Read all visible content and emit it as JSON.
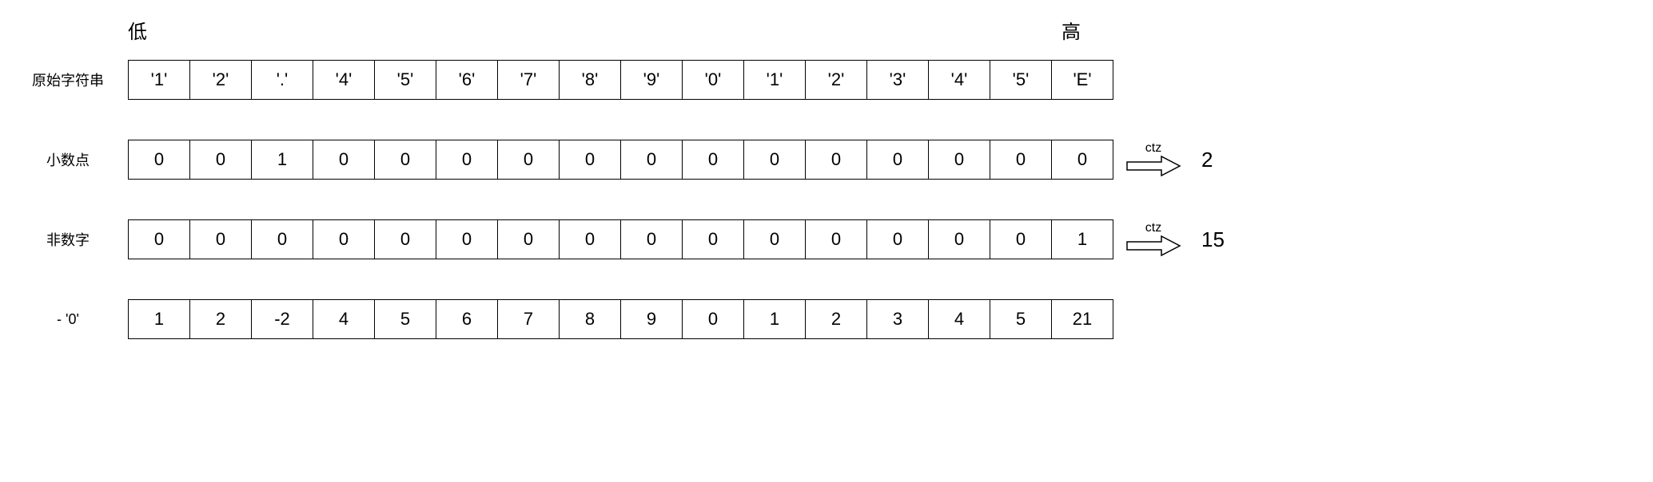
{
  "header": {
    "low": "低",
    "high": "高"
  },
  "rows": [
    {
      "label": "原始字符串",
      "cells": [
        "'1'",
        "'2'",
        "'.'",
        "'4'",
        "'5'",
        "'6'",
        "'7'",
        "'8'",
        "'9'",
        "'0'",
        "'1'",
        "'2'",
        "'3'",
        "'4'",
        "'5'",
        "'E'"
      ],
      "arrow": null,
      "result": null
    },
    {
      "label": "小数点",
      "cells": [
        "0",
        "0",
        "1",
        "0",
        "0",
        "0",
        "0",
        "0",
        "0",
        "0",
        "0",
        "0",
        "0",
        "0",
        "0",
        "0"
      ],
      "arrow": "ctz",
      "result": "2"
    },
    {
      "label": "非数字",
      "cells": [
        "0",
        "0",
        "0",
        "0",
        "0",
        "0",
        "0",
        "0",
        "0",
        "0",
        "0",
        "0",
        "0",
        "0",
        "0",
        "1"
      ],
      "arrow": "ctz",
      "result": "15"
    },
    {
      "label": "- '0'",
      "cells": [
        "1",
        "2",
        "-2",
        "4",
        "5",
        "6",
        "7",
        "8",
        "9",
        "0",
        "1",
        "2",
        "3",
        "4",
        "5",
        "21"
      ],
      "arrow": null,
      "result": null
    }
  ]
}
